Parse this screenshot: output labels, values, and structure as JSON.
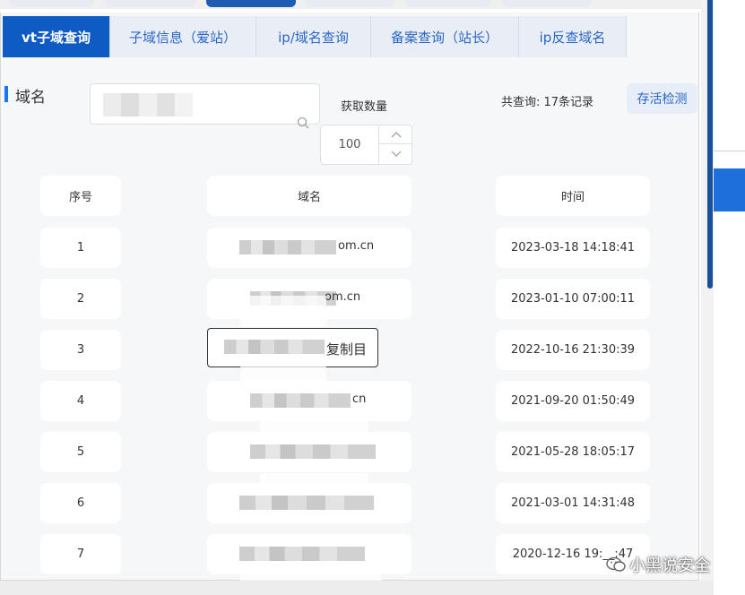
{
  "tabs": [
    {
      "label": "vt子域查询",
      "active": true
    },
    {
      "label": "子域信息（爱站）",
      "active": false
    },
    {
      "label": "ip/域名查询",
      "active": false
    },
    {
      "label": "备案查询（站长）",
      "active": false
    },
    {
      "label": "ip反查域名",
      "active": false
    }
  ],
  "form": {
    "domain_label": "域名",
    "count_label": "获取数量",
    "count_value": "100",
    "total_text": "共查询: 17条记录",
    "alive_button": "存活检测"
  },
  "table": {
    "headers": {
      "index": "序号",
      "domain": "域名",
      "time": "时间"
    },
    "rows": [
      {
        "index": "1",
        "domain_suffix": "om.cn",
        "time": "2023-03-18 14:18:41"
      },
      {
        "index": "2",
        "domain_suffix": "om.cn",
        "time": "2023-01-10 07:00:11"
      },
      {
        "index": "3",
        "domain_suffix": "",
        "time": "2022-10-16 21:30:39"
      },
      {
        "index": "4",
        "domain_suffix": "cn",
        "time": "2021-09-20 01:50:49"
      },
      {
        "index": "5",
        "domain_suffix": "",
        "time": "2021-05-28 18:05:17"
      },
      {
        "index": "6",
        "domain_suffix": "",
        "time": "2021-03-01 14:31:48"
      },
      {
        "index": "7",
        "domain_suffix": "",
        "time": "2020-12-16 19:__:47"
      }
    ],
    "copy_label": "复制目"
  },
  "watermark": "小黑说安全",
  "colors": {
    "accent": "#0f5bc4",
    "tab_text": "#2a66c7",
    "panel_bg": "#f6f7f9"
  }
}
